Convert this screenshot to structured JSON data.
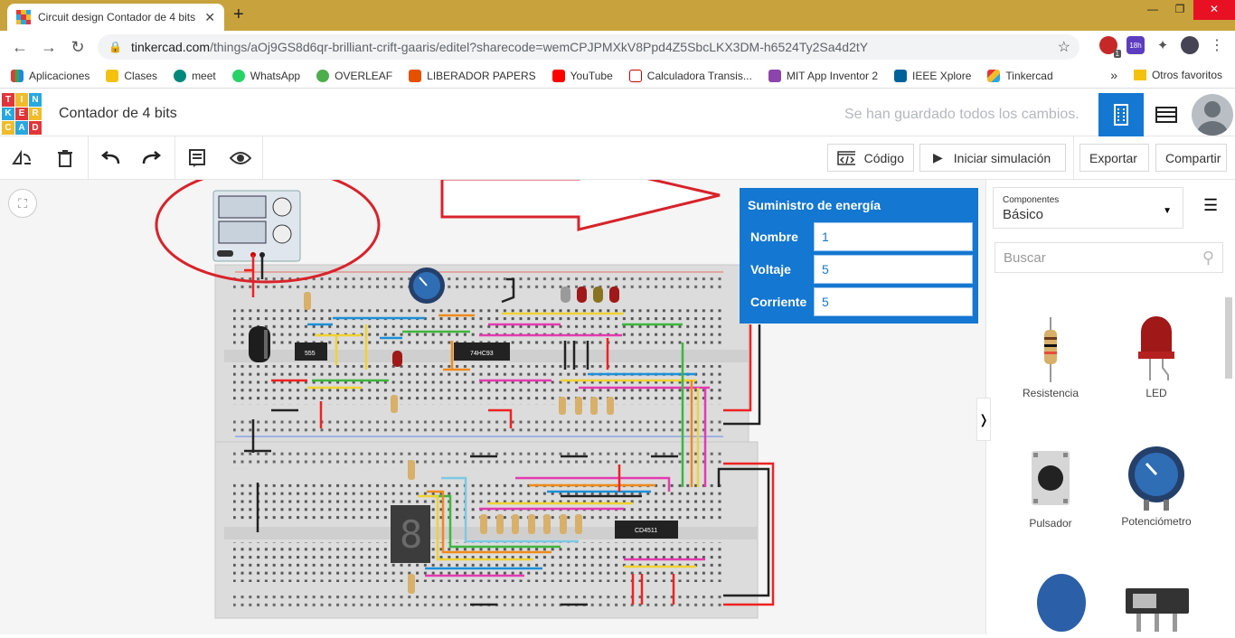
{
  "browser": {
    "tab_title": "Circuit design Contador de 4 bits",
    "url_host": "tinkercad.com",
    "url_path": "/things/aOj9GS8d6qr-brilliant-crift-gaaris/editel?sharecode=wemCPJPMXkV8Ppd4Z5SbcLKX3DM-h6524Ty2Sa4d2tY",
    "ext_badge": "18h",
    "ext_count": "1"
  },
  "bookmarks": {
    "items": [
      "Aplicaciones",
      "Clases",
      "meet",
      "WhatsApp",
      "OVERLEAF",
      "LIBERADOR PAPERS",
      "YouTube",
      "Calculadora Transis...",
      "MIT App Inventor 2",
      "IEEE Xplore",
      "Tinkercad"
    ],
    "more": "»",
    "other": "Otros favoritos"
  },
  "app": {
    "logo_letters": [
      "T",
      "I",
      "N",
      "K",
      "E",
      "R",
      "C",
      "A",
      "D"
    ],
    "title": "Contador de 4 bits",
    "save_status": "Se han guardado todos los cambios."
  },
  "toolbar": {
    "code_label": "Código",
    "simulate_label": "Iniciar simulación",
    "export_label": "Exportar",
    "share_label": "Compartir"
  },
  "properties": {
    "title": "Suministro de energía",
    "name_label": "Nombre",
    "name_value": "1",
    "voltage_label": "Voltaje",
    "voltage_value": "5",
    "current_label": "Corriente",
    "current_value": "5"
  },
  "circuit": {
    "chip_555": "555",
    "chip_74hc93": "74HC93",
    "chip_cd4511": "CD4511",
    "row_labels": [
      "1",
      "5",
      "10",
      "15",
      "20",
      "25",
      "30",
      "35",
      "40",
      "45",
      "50",
      "55",
      "60"
    ]
  },
  "sidebar": {
    "components_small": "Componentes",
    "components_value": "Básico",
    "search_placeholder": "Buscar",
    "components": [
      "Resistencia",
      "LED",
      "Pulsador",
      "Potenciómetro"
    ]
  },
  "colors": {
    "accent": "#1477d1",
    "annotation_red": "#d8232a",
    "tab_bar": "#c8a23c"
  }
}
